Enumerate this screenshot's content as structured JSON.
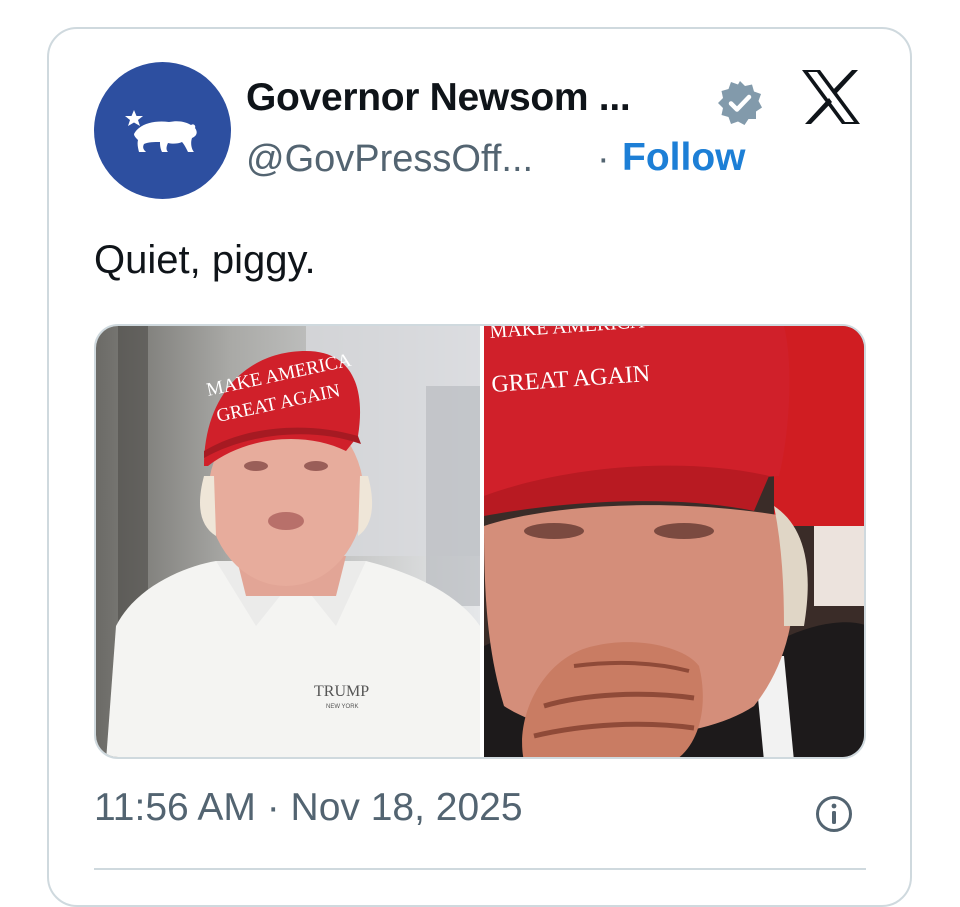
{
  "tweet": {
    "author_name": "Governor Newsom ...",
    "handle": "@GovPressOff...",
    "separator": "·",
    "follow_label": "Follow",
    "text": "Quiet, piggy.",
    "timestamp": "11:56 AM · Nov 18, 2025"
  },
  "media": {
    "left_image": {
      "hat_line1": "MAKE AMERICA",
      "hat_line2": "GREAT AGAIN",
      "shirt_logo": "TRUMP",
      "shirt_sublogo": "NEW YORK"
    },
    "right_image": {
      "hat_line1": "MAKE AMERICA",
      "hat_line2": "GREAT AGAIN"
    }
  },
  "icons": {
    "verified": "verified-badge-icon",
    "platform": "x-logo-icon",
    "info": "info-icon",
    "avatar": "california-bear-icon"
  },
  "colors": {
    "follow": "#1d7fd6",
    "avatar_bg": "#2d4fa0",
    "hat_red": "#d0202a",
    "muted_text": "#536471"
  }
}
